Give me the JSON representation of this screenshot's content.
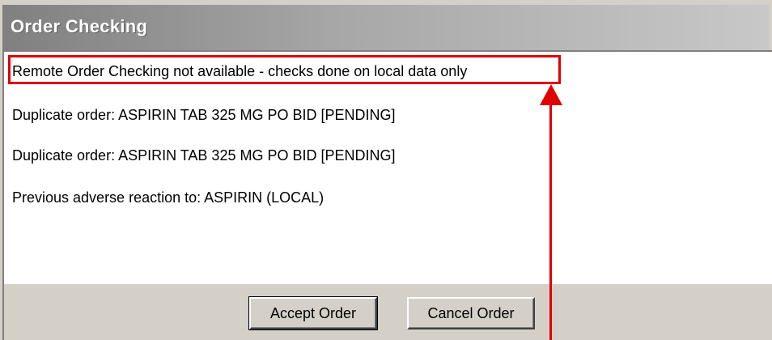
{
  "window": {
    "title": "Order Checking"
  },
  "messages": [
    "Remote Order Checking not available - checks done on local data only",
    "Duplicate order: ASPIRIN TAB  325 MG PO BID  [PENDING]",
    "Duplicate order: ASPIRIN TAB  325 MG PO BID  [PENDING]",
    "Previous adverse reaction to: ASPIRIN (LOCAL)"
  ],
  "buttons": {
    "accept_label": "Accept Order",
    "cancel_label": "Cancel Order"
  },
  "annotation": {
    "color": "#e00000"
  }
}
